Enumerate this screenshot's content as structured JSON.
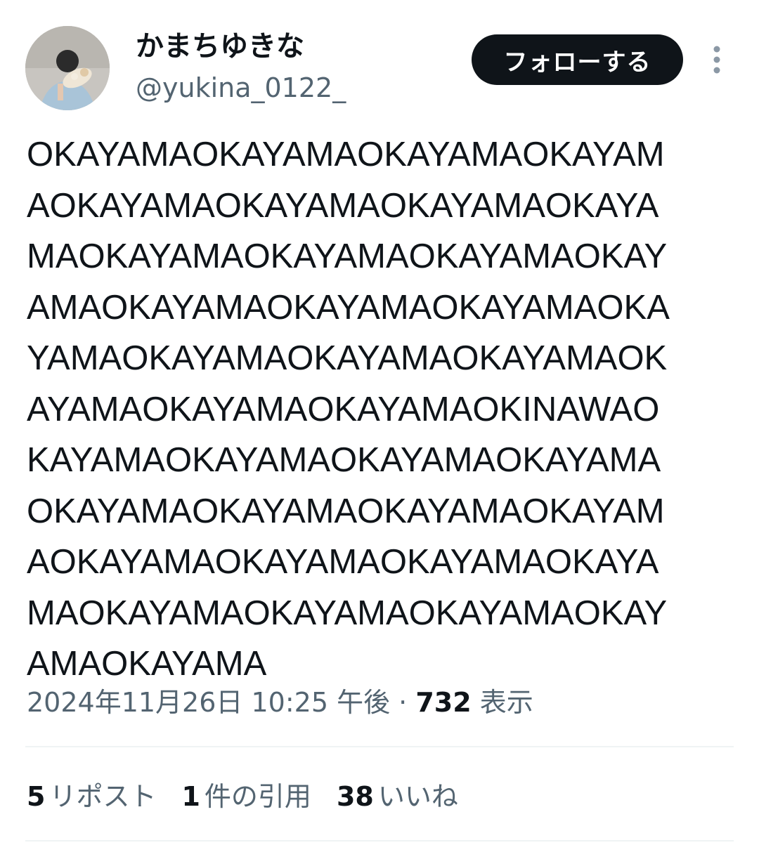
{
  "author": {
    "display_name": "かまちゆきな",
    "handle": "@yukina_0122_",
    "avatar_icon": "profile-photo"
  },
  "actions": {
    "follow_label": "フォローする",
    "more_icon": "more-vertical-icon"
  },
  "tweet": {
    "lines": [
      "OKAYAMAOKAYAMAOKAYAMAOKAYAM",
      "AOKAYAMAOKAYAMAOKAYAMAOKAYA",
      "MAOKAYAMAOKAYAMAOKAYAMAOKAY",
      "AMAOKAYAMAOKAYAMAOKAYAMAOKA",
      "YAMAOKAYAMAOKAYAMAOKAYAMAOK",
      "AYAMAOKAYAMAOKAYAMAOKINAWAO",
      "KAYAMAOKAYAMAOKAYAMAOKAYAMA",
      "OKAYAMAOKAYAMAOKAYAMAOKAYAM",
      "AOKAYAMAOKAYAMAOKAYAMAOKAYA",
      "MAOKAYAMAOKAYAMAOKAYAMAOKAY",
      "AMAOKAYAMA"
    ]
  },
  "meta": {
    "timestamp": "2024年11月26日 10:25 午後",
    "separator": " · ",
    "views_count": "732",
    "views_label": " 表示"
  },
  "stats": {
    "reposts_count": "5",
    "reposts_label": "リポスト",
    "quotes_count": "1",
    "quotes_label": "件の引用",
    "likes_count": "38",
    "likes_label": "いいね"
  },
  "colors": {
    "text_primary": "#0f1419",
    "text_secondary": "#536471",
    "divider": "#eff3f4",
    "button_bg": "#0f1419"
  }
}
